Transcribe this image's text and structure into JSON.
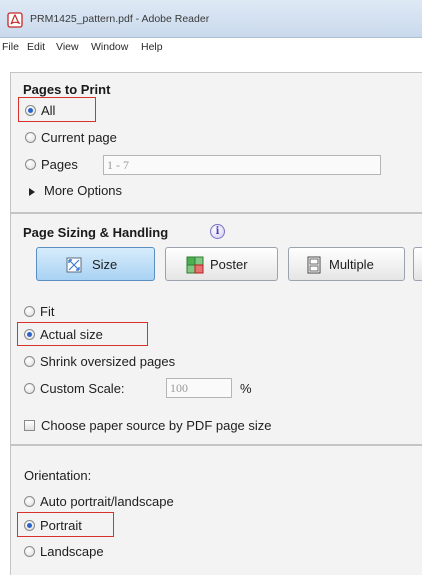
{
  "window": {
    "title": "PRM1425_pattern.pdf - Adobe Reader",
    "icon": "pdf-icon"
  },
  "menubar": {
    "items": [
      "File",
      "Edit",
      "View",
      "Window",
      "Help"
    ]
  },
  "pages_to_print": {
    "title": "Pages to Print",
    "all_label": "All",
    "current_label": "Current page",
    "pages_label": "Pages",
    "pages_value": "1 - 7",
    "more_options": "More Options",
    "selected": "All"
  },
  "sizing": {
    "title": "Page Sizing & Handling",
    "info_icon": "i",
    "size_button": "Size",
    "poster_button": "Poster",
    "multiple_button": "Multiple",
    "fit_label": "Fit",
    "actual_label": "Actual size",
    "shrink_label": "Shrink oversized pages",
    "custom_label": "Custom Scale:",
    "custom_value": "100",
    "custom_unit": "%",
    "paper_source_label": "Choose paper source by PDF page size",
    "selected": "Actual size",
    "active_button": "Size"
  },
  "orientation": {
    "title": "Orientation:",
    "auto_label": "Auto portrait/landscape",
    "portrait_label": "Portrait",
    "landscape_label": "Landscape",
    "selected": "Portrait"
  },
  "colors": {
    "highlight_box": "#d9322b",
    "radio_dot": "#2b63c8",
    "active_button": "#a9d2f3"
  }
}
